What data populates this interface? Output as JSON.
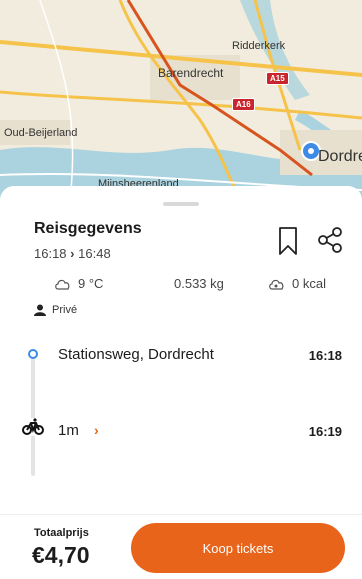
{
  "map": {
    "labels": {
      "ridderkerk": "Ridderkerk",
      "barendrecht": "Barendrecht",
      "oud_beijerland": "Oud-Beijerland",
      "dordrecht": "Dordre",
      "mijnsheerenland": "Mijnsheerenland"
    },
    "roads": {
      "a15": "A15",
      "a16": "A16"
    },
    "colors": {
      "route": "#d7541f",
      "location_pin": "#3d8be6"
    }
  },
  "trip": {
    "title": "Reisgegevens",
    "depart": "16:18",
    "arrive": "16:48",
    "actions": {
      "bookmark_icon": "bookmark-icon",
      "share_icon": "share-icon"
    },
    "stats": {
      "temperature": "9 °C",
      "co2": "0.533 kg",
      "calories": "0 kcal"
    },
    "privacy": "Privé"
  },
  "legs": {
    "start": {
      "name": "Stationsweg, Dordrecht",
      "time": "16:18"
    },
    "bike": {
      "duration": "1m",
      "time": "16:19"
    }
  },
  "footer": {
    "total_label": "Totaalprijs",
    "total_price": "€4,70",
    "buy_label": "Koop tickets",
    "accent_color": "#e8641a"
  }
}
